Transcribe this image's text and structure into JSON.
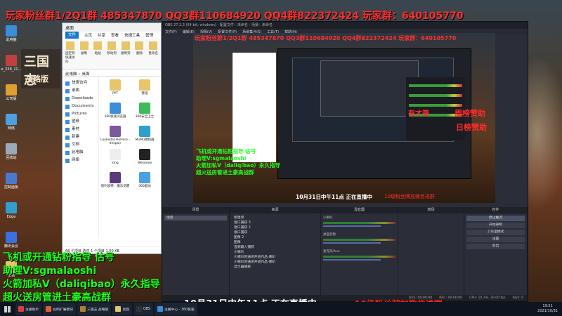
{
  "overlays": {
    "top_banner": "玩家粉丝群1/2Q1群 485347870 QQ3群110684920 QQ4群822372424 玩家群：640105770",
    "green_lines": [
      "飞机或开通钻粉指导 估号",
      "助理V:sgmalaoshi",
      "火箭加私V（daliqibao）永久指导",
      "超火送房管进土豪高战群"
    ],
    "live_text": "10月31日中午11点 正在直播中",
    "fans_text": "10级粉丝牌加微信进群",
    "sponsor_week": "周榜赞助",
    "sponsor_day": "日榜赞助",
    "sponsor_name": "有才哥",
    "game_logo_top": "三国志",
    "game_logo_bottom": "战略版"
  },
  "desktop": {
    "icons": [
      {
        "label": "此电脑",
        "color": "#3a8fd8"
      },
      {
        "label": "e_228_21...",
        "color": "#c04040"
      },
      {
        "label": "公司版",
        "color": "#e0a030"
      },
      {
        "label": "网络",
        "color": "#4aa0e0"
      },
      {
        "label": "回收站",
        "color": "#9ab"
      },
      {
        "label": "控制面板",
        "color": "#4a7ad0"
      },
      {
        "label": "Edge",
        "color": "#2f9fd0"
      },
      {
        "label": "腾讯会议",
        "color": "#3a70e0"
      },
      {
        "label": "文档",
        "color": "#e8c46a"
      }
    ]
  },
  "explorer": {
    "title": "桌面",
    "tabs": [
      "文件",
      "主页",
      "共享",
      "查看",
      "快捷工具",
      "管理"
    ],
    "ribbon": [
      "固定到快速访问",
      "复制",
      "粘贴",
      "移动到",
      "复制到",
      "删除",
      "重命名",
      "新建文件夹",
      "属性",
      "打开",
      "选择"
    ],
    "path": [
      "此电脑",
      "桌面"
    ],
    "nav": [
      "快速访问",
      "桌面",
      "Downloads",
      "Documents",
      "Pictures",
      "壁纸",
      "素材",
      "新建",
      "文档",
      "此电脑",
      "网络"
    ],
    "files": [
      {
        "label": "PPT",
        "color": "#e8c46a"
      },
      {
        "label": "壁纸",
        "color": "#e8c46a"
      },
      {
        "label": "360极速浏览器",
        "color": "#3a8fd8"
      },
      {
        "label": "360安全卫士",
        "color": "#3cbb5a"
      },
      {
        "label": "Lookedat HeHore - despair",
        "color": "#7a5a9a"
      },
      {
        "label": "MuMu模拟器",
        "color": "#2f9fd0"
      },
      {
        "label": "king",
        "color": "#eee"
      },
      {
        "label": "WeGame",
        "color": "#222"
      },
      {
        "label": "哈利波特：魔法觉醒",
        "color": "#5a3a7a"
      },
      {
        "label": "360驱动",
        "color": "#4aa0e0"
      }
    ],
    "status": "68 个项目  选中 1 个项目 1.00 KB"
  },
  "obs": {
    "title": "OBS 27.1.3 (64-bit, windows) - 配置文件：未命名 - 场景：未命名",
    "menu": [
      "文件(F)",
      "编辑(E)",
      "视图(V)",
      "配置文件(P)",
      "场景集合(S)",
      "工具(T)",
      "帮助(H)"
    ],
    "docks": {
      "scenes": "场景",
      "sources": "来源",
      "mixer": "混音器",
      "transitions": "转场",
      "controls": "控件"
    },
    "scene_items": [
      "场景"
    ],
    "source_items": [
      "新建项",
      "窗口捕获 3",
      "窗口捕获 2",
      "窗口捕获",
      "图像 2",
      "图像",
      "音频输入捕获",
      "小喇叭",
      "小喇叭的通讯开始作品-喇叭",
      "小喇叭的通讯开始作品-喇叭",
      "显示器捕获"
    ],
    "mixer_channels": [
      "小喇叭",
      "桌面音频",
      "麦克风/Aux"
    ],
    "control_buttons": [
      "停止推流",
      "开始录制",
      "工作室模式",
      "设置",
      "退出"
    ],
    "status": {
      "live": "LIVE: 00:00:00",
      "rec": "REC: 00:00:00",
      "cpu": "CPU: 10.1%, 30.00 fps",
      "kbps": "kb/s: 0"
    }
  },
  "taskbar": {
    "items": [
      {
        "label": "主播助手",
        "color": "#d84040"
      },
      {
        "label": "右侧扩展模块",
        "color": "#e06030"
      },
      {
        "label": "三国志·战略版",
        "color": "#b08030"
      },
      {
        "label": "桌面",
        "color": "#e8c46a"
      },
      {
        "label": "OBS",
        "color": "#333"
      },
      {
        "label": "主播中心 - 360极速",
        "color": "#3a8fd8"
      }
    ],
    "time": "19:51",
    "date": "2021/10/31"
  }
}
